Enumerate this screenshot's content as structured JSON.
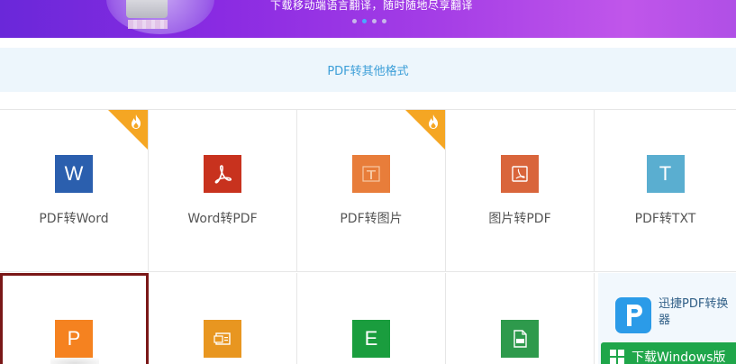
{
  "banner": {
    "slogan": "下载移动端语言翻译，随时随地尽享翻译",
    "carousel_dots": 4,
    "active_dot": 1
  },
  "section": {
    "title": "PDF转其他格式"
  },
  "tools_row1": [
    {
      "label": "PDF转Word",
      "icon_letter": "W",
      "icon": "word-icon",
      "color": "#2b5fae",
      "hot": true
    },
    {
      "label": "Word转PDF",
      "icon_letter": "",
      "icon": "pdf-acrobat-icon",
      "color": "#c8321e",
      "hot": false
    },
    {
      "label": "PDF转图片",
      "icon_letter": "",
      "icon": "pdf-image-icon",
      "color": "#e87d3a",
      "hot": true
    },
    {
      "label": "图片转PDF",
      "icon_letter": "",
      "icon": "image-pdf-icon",
      "color": "#d9653b",
      "hot": false
    },
    {
      "label": "PDF转TXT",
      "icon_letter": "T",
      "icon": "txt-icon",
      "color": "#5aaed0",
      "hot": false
    }
  ],
  "tools_row2": [
    {
      "icon_letter": "P",
      "icon": "ppt-icon",
      "color": "#f58220"
    },
    {
      "icon_letter": "",
      "icon": "pdf-ppt-icon",
      "color": "#e89620"
    },
    {
      "icon_letter": "E",
      "icon": "excel-icon",
      "color": "#1a9d3e"
    },
    {
      "icon_letter": "",
      "icon": "pdf-file-icon",
      "color": "#2e9a4c"
    }
  ],
  "promo": {
    "app_name": "迅捷PDF转换器",
    "download_label": "下载Windows版"
  },
  "colors": {
    "banner_start": "#6a28d9",
    "banner_end": "#c056ea",
    "section_bg": "#edf6fc",
    "section_text": "#3d9fd8",
    "hot_badge": "#f5a623",
    "selection": "#7a1818",
    "download_green": "#1fa64a"
  }
}
